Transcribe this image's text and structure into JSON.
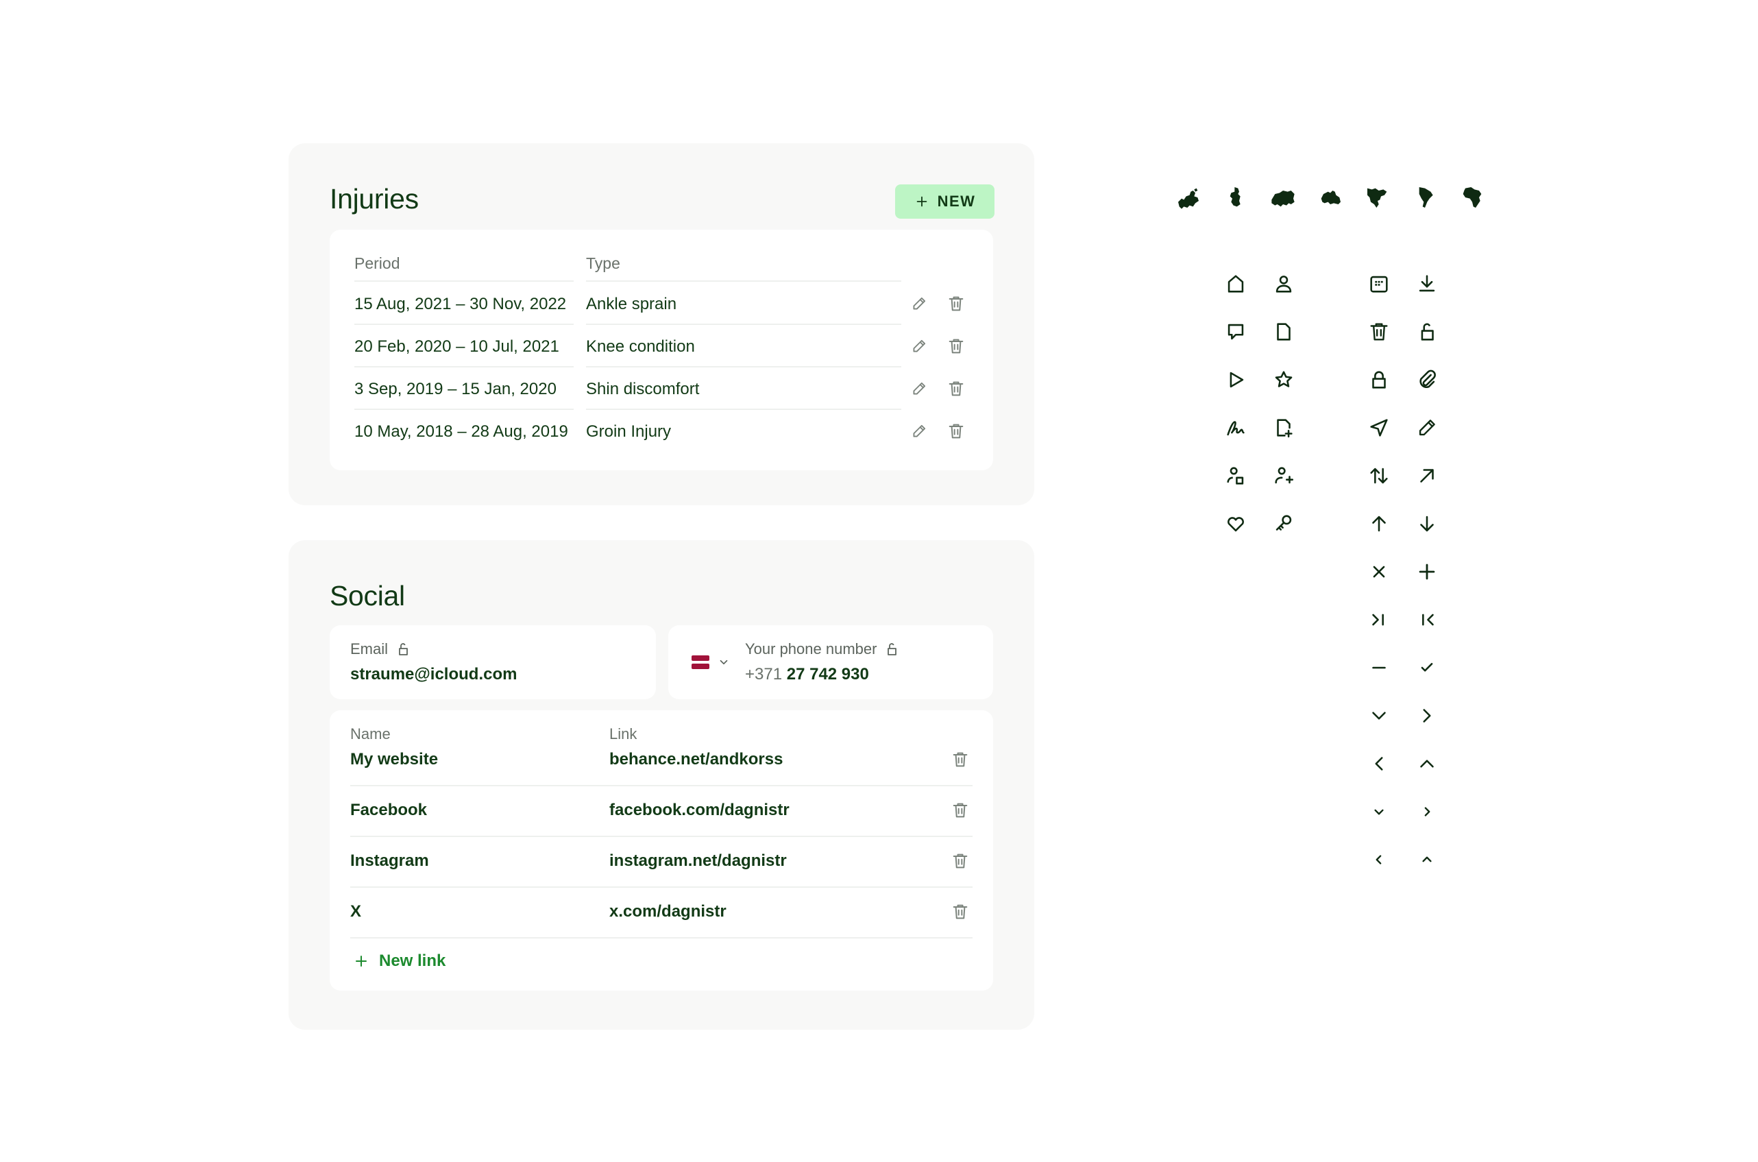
{
  "injuries": {
    "title": "Injuries",
    "new_label": "NEW",
    "columns": [
      "Period",
      "Type"
    ],
    "rows": [
      {
        "period": "15 Aug, 2021 – 30 Nov, 2022",
        "type": "Ankle sprain"
      },
      {
        "period": "20 Feb, 2020 – 10 Jul, 2021",
        "type": "Knee condition"
      },
      {
        "period": "3 Sep, 2019 – 15 Jan, 2020",
        "type": "Shin discomfort"
      },
      {
        "period": "10 May, 2018 – 28 Aug, 2019",
        "type": "Groin Injury"
      }
    ]
  },
  "social": {
    "title": "Social",
    "email": {
      "label": "Email",
      "value": "straume@icloud.com"
    },
    "phone": {
      "label": "Your phone number",
      "prefix": "+371",
      "value": "27 742 930",
      "flag": "latvia"
    },
    "columns": [
      "Name",
      "Link"
    ],
    "links": [
      {
        "name": "My website",
        "url": "behance.net/andkorss"
      },
      {
        "name": "Facebook",
        "url": "facebook.com/dagnistr"
      },
      {
        "name": "Instagram",
        "url": "instagram.net/dagnistr"
      },
      {
        "name": "X",
        "url": "x.com/dagnistr"
      }
    ],
    "new_link_label": "New link"
  },
  "colors": {
    "accent_bg": "#bdf5c5",
    "accent_text": "#1c8a2e",
    "text": "#123a16",
    "card_bg": "#f8f8f7"
  },
  "icon_set": {
    "continents": [
      "europe-icon",
      "asia-icon",
      "russia-icon",
      "australia-icon",
      "north-america-icon",
      "south-america-icon",
      "africa-icon"
    ],
    "left_grid": [
      "home-icon",
      "user-icon",
      "chat-icon",
      "document-icon",
      "play-icon",
      "star-icon",
      "signature-icon",
      "add-document-icon",
      "users-icon",
      "add-user-icon",
      "heart-icon",
      "key-icon"
    ],
    "right_grid": [
      "calendar-icon",
      "download-icon",
      "trash-icon",
      "unlock-icon",
      "lock-icon",
      "paperclip-icon",
      "send-icon",
      "pencil-icon",
      "sort-icon",
      "arrow-up-right-icon",
      "arrow-up-icon",
      "arrow-down-icon",
      "close-icon",
      "plus-icon",
      "skip-forward-icon",
      "skip-back-icon",
      "minus-icon",
      "check-icon",
      "chevron-down-icon",
      "chevron-right-icon",
      "chevron-left-icon",
      "chevron-up-icon",
      "chevron-down-small-icon",
      "chevron-right-small-icon",
      "chevron-left-small-icon",
      "chevron-up-small-icon"
    ]
  }
}
